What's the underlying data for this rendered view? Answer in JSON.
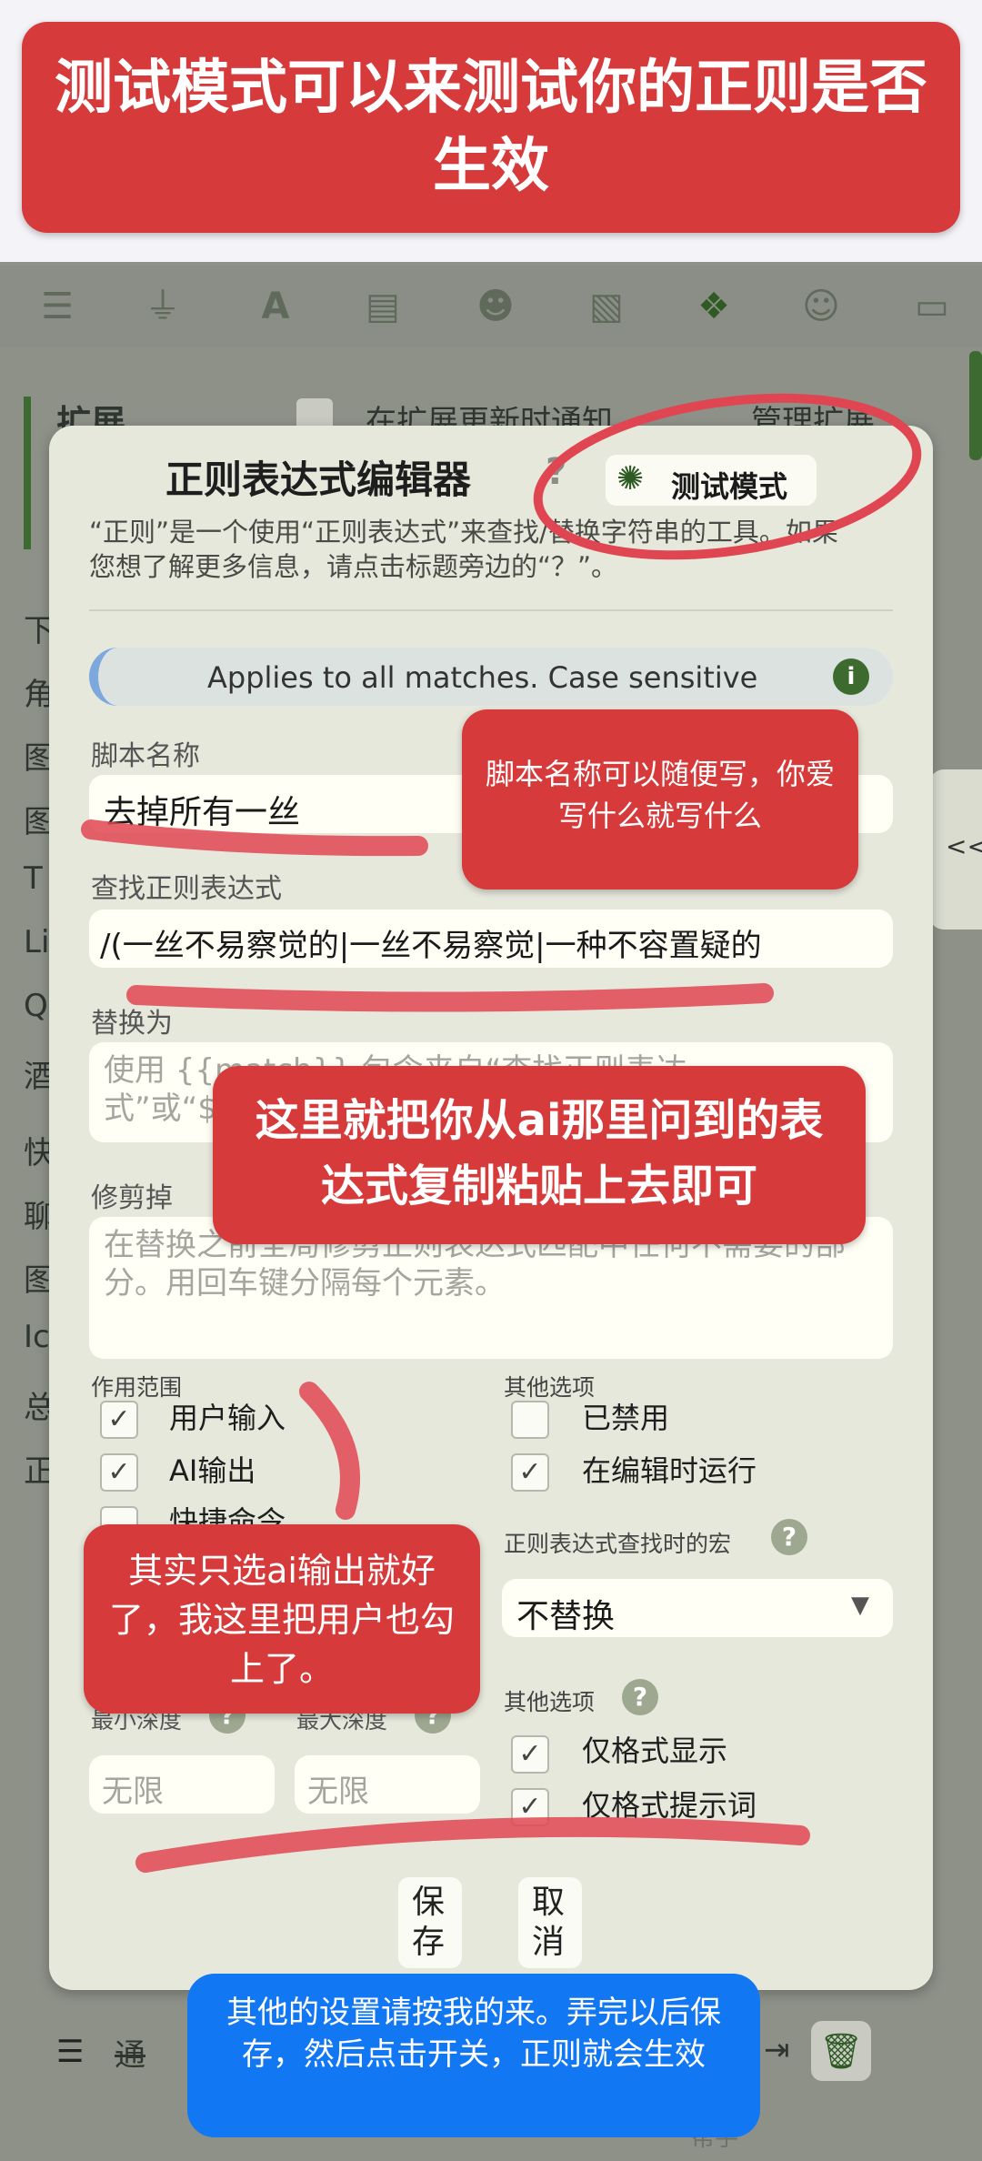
{
  "banner": {
    "text": "测试模式可以来测试你的正则是否生效"
  },
  "background_app": {
    "section_title": "扩展",
    "notify_label": "在扩展更新时通知",
    "manage_label": "管理扩展",
    "side_letters": [
      "下",
      "角",
      "图",
      "图",
      "T",
      "Li",
      "Q",
      "酒",
      "快",
      "聊",
      "图",
      "Ic",
      "总",
      "正"
    ],
    "bottom_item": "通",
    "bottom_hint": "帮手",
    "collapse_label": "<<"
  },
  "dialog": {
    "title": "正则表达式编辑器",
    "help_symbol": "?",
    "test_mode_label": "测试模式",
    "description": "“正则”是一个使用“正则表达式”来查找/替换字符串的工具。如果您想了解更多信息，请点击标题旁边的“？”。",
    "info_banner": "Applies to all matches. Case sensitive",
    "script_name_label": "脚本名称",
    "script_name_value": "去掉所有一丝",
    "find_regex_label": "查找正则表达式",
    "find_regex_value": "/(一丝不易察觉的|一丝不易察觉|一种不容置疑的",
    "replace_label": "替换为",
    "replace_placeholder": "使用 {{match}} 包含来自“查找正则表达式”或“$1”、“$2”等的匹配文本作为捕获组。",
    "trim_label": "修剪掉",
    "trim_placeholder": "在替换之前全局修剪正则表达式匹配中任何不需要的部分。用回车键分隔每个元素。",
    "scope_label": "作用范围",
    "scope_options": [
      {
        "label": "用户输入",
        "checked": true
      },
      {
        "label": "AI输出",
        "checked": true
      },
      {
        "label": "快捷命令",
        "checked": false
      }
    ],
    "other_options_label": "其他选项",
    "other_options": [
      {
        "label": "已禁用",
        "checked": false
      },
      {
        "label": "在编辑时运行",
        "checked": true
      }
    ],
    "macro_label": "正则表达式查找时的宏",
    "macro_value": "不替换",
    "min_depth_label": "最小深度",
    "max_depth_label": "最大深度",
    "min_depth_placeholder": "无限",
    "max_depth_placeholder": "无限",
    "other_options2_label": "其他选项",
    "format_options": [
      {
        "label": "仅格式显示",
        "checked": true
      },
      {
        "label": "仅格式提示词",
        "checked": true
      }
    ],
    "save_label": "保存",
    "cancel_label": "取消"
  },
  "annotations": {
    "script_name_note": "脚本名称可以随便写，你爱写什么就写什么",
    "regex_note": "这里就把你从ai那里问到的表达式复制粘贴上去即可",
    "scope_note": "其实只选ai输出就好了，我这里把用户也勾上了。",
    "bottom_note": "其他的设置请按我的来。弄完以后保存，然后点击开关，正则就会生效"
  },
  "colors": {
    "dialog_bg": "#e7e8dc",
    "annotation_red": "#d63a3a",
    "annotation_blue": "#1177f2",
    "accent_green": "#3d6b2f"
  }
}
